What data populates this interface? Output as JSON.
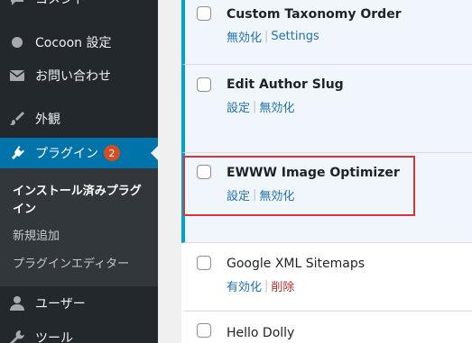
{
  "sidebar": {
    "comment_partial": "コメント",
    "items": [
      {
        "label": "Cocoon 設定",
        "icon": "circle-icon"
      },
      {
        "label": "お問い合わせ",
        "icon": "mail-icon"
      },
      {
        "label": "外観",
        "icon": "brush-icon"
      },
      {
        "label": "プラグイン",
        "icon": "plugin-icon",
        "badge": "2"
      }
    ],
    "submenu": [
      "インストール済みプラグイン",
      "新規追加",
      "プラグインエディター"
    ],
    "lower_items": [
      {
        "label": "ユーザー",
        "icon": "user-icon"
      },
      {
        "label": "ツール",
        "icon": "wrench-icon"
      }
    ]
  },
  "plugins": [
    {
      "name": "Custom Taxonomy Order",
      "status": "active",
      "actions": [
        "無効化",
        "Settings"
      ]
    },
    {
      "name": "Edit Author Slug",
      "status": "active",
      "actions": [
        "設定",
        "無効化"
      ]
    },
    {
      "name": "EWWW Image Optimizer",
      "status": "active",
      "actions": [
        "設定",
        "無効化"
      ]
    },
    {
      "name": "Google XML Sitemaps",
      "status": "inactive",
      "actions": [
        "有効化",
        "削除"
      ]
    },
    {
      "name": "Hello Dolly",
      "status": "inactive",
      "actions": []
    }
  ],
  "colors": {
    "sidebar_bg": "#23282d",
    "active_menu": "#0073aa",
    "active_plugin_border": "#00a0d2",
    "link": "#2271b1",
    "delete_link": "#b32d2e",
    "highlight_box": "#d63638",
    "badge": "#d54e21"
  }
}
